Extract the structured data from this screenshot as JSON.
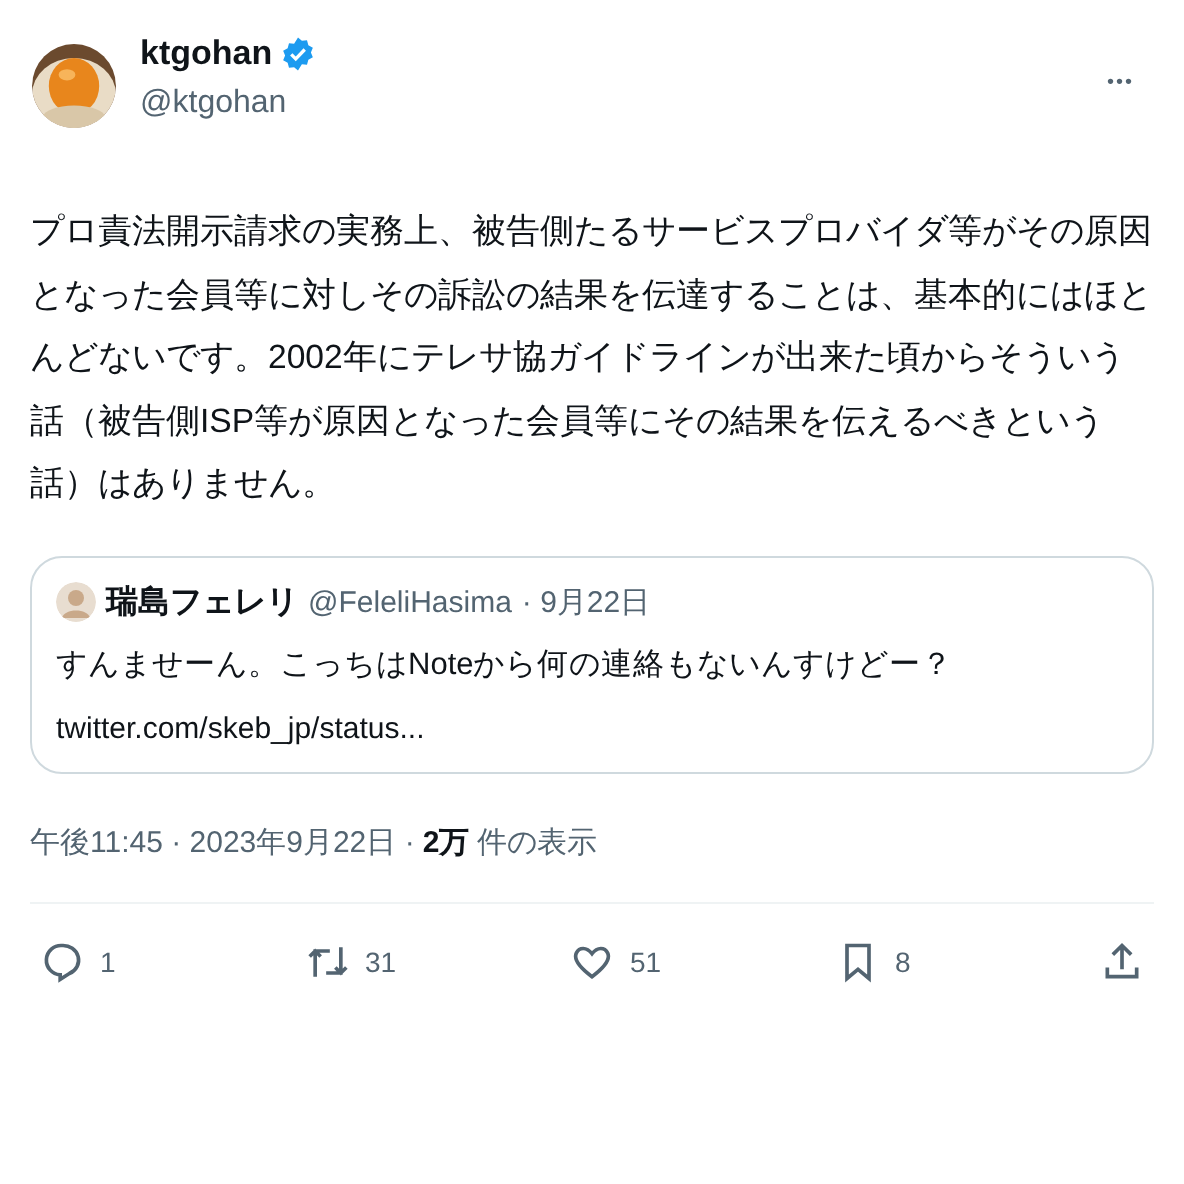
{
  "author": {
    "name": "ktgohan",
    "handle": "@ktgohan",
    "verified": true
  },
  "menu": "•••",
  "text": "プロ責法開示請求の実務上、被告側たるサービスプロバイダ等がその原因となった会員等に対しその訴訟の結果を伝達することは、基本的にはほとんどないです。2002年にテレサ協ガイドラインが出来た頃からそういう話（被告側ISP等が原因となった会員等にその結果を伝えるべきという話）はありません。",
  "quote": {
    "name": "瑞島フェレリ",
    "handle": "@FeleliHasima",
    "date": "· 9月22日",
    "text": "すんませーん。こっちはNoteから何の連絡もないんすけどー？",
    "link": "twitter.com/skeb_jp/status..."
  },
  "meta": {
    "time": "午後11:45 · 2023年9月22日 ·",
    "views": "2万",
    "views_label": "件の表示"
  },
  "actions": [
    {
      "kind": "reply",
      "count": "1"
    },
    {
      "kind": "retweet",
      "count": "31"
    },
    {
      "kind": "like",
      "count": "51"
    },
    {
      "kind": "bookmark",
      "count": "8"
    },
    {
      "kind": "share"
    }
  ]
}
